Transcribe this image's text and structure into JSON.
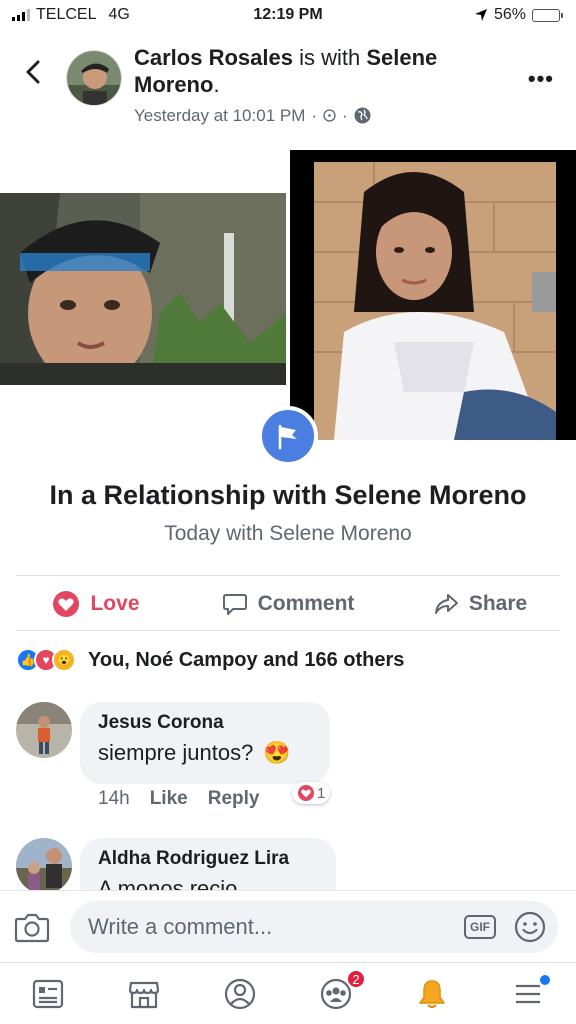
{
  "status_bar": {
    "carrier": "TELCEL",
    "network": "4G",
    "time": "12:19 PM",
    "battery": "56%",
    "battery_level": 0.56
  },
  "post": {
    "author": "Carlos Rosales",
    "with_text": "is with",
    "tagged": "Selene Moreno",
    "timestamp": "Yesterday at 10:01 PM",
    "more_icon": "more-dots-icon"
  },
  "life_event": {
    "title": "In a Relationship with Selene Moreno",
    "subtitle": "Today with Selene Moreno"
  },
  "actions": {
    "love": "Love",
    "comment": "Comment",
    "share": "Share"
  },
  "reactions": {
    "summary": "You, Noé Campoy and 166 others"
  },
  "comments": [
    {
      "name": "Jesus Corona",
      "text": "siempre juntos?",
      "emoji": "😍",
      "time": "14h",
      "like": "Like",
      "reply": "Reply",
      "reaction_count": "1"
    },
    {
      "name": "Aldha Rodriguez Lira",
      "text": "A monos recio"
    }
  ],
  "composer": {
    "placeholder": "Write a comment...",
    "gif_label": "GIF"
  },
  "tab_bar": {
    "groups_badge": "2"
  },
  "colors": {
    "accent": "#4a7ee0",
    "love": "#e2475f",
    "text_secondary": "#606770",
    "badge": "#e41e3f"
  }
}
